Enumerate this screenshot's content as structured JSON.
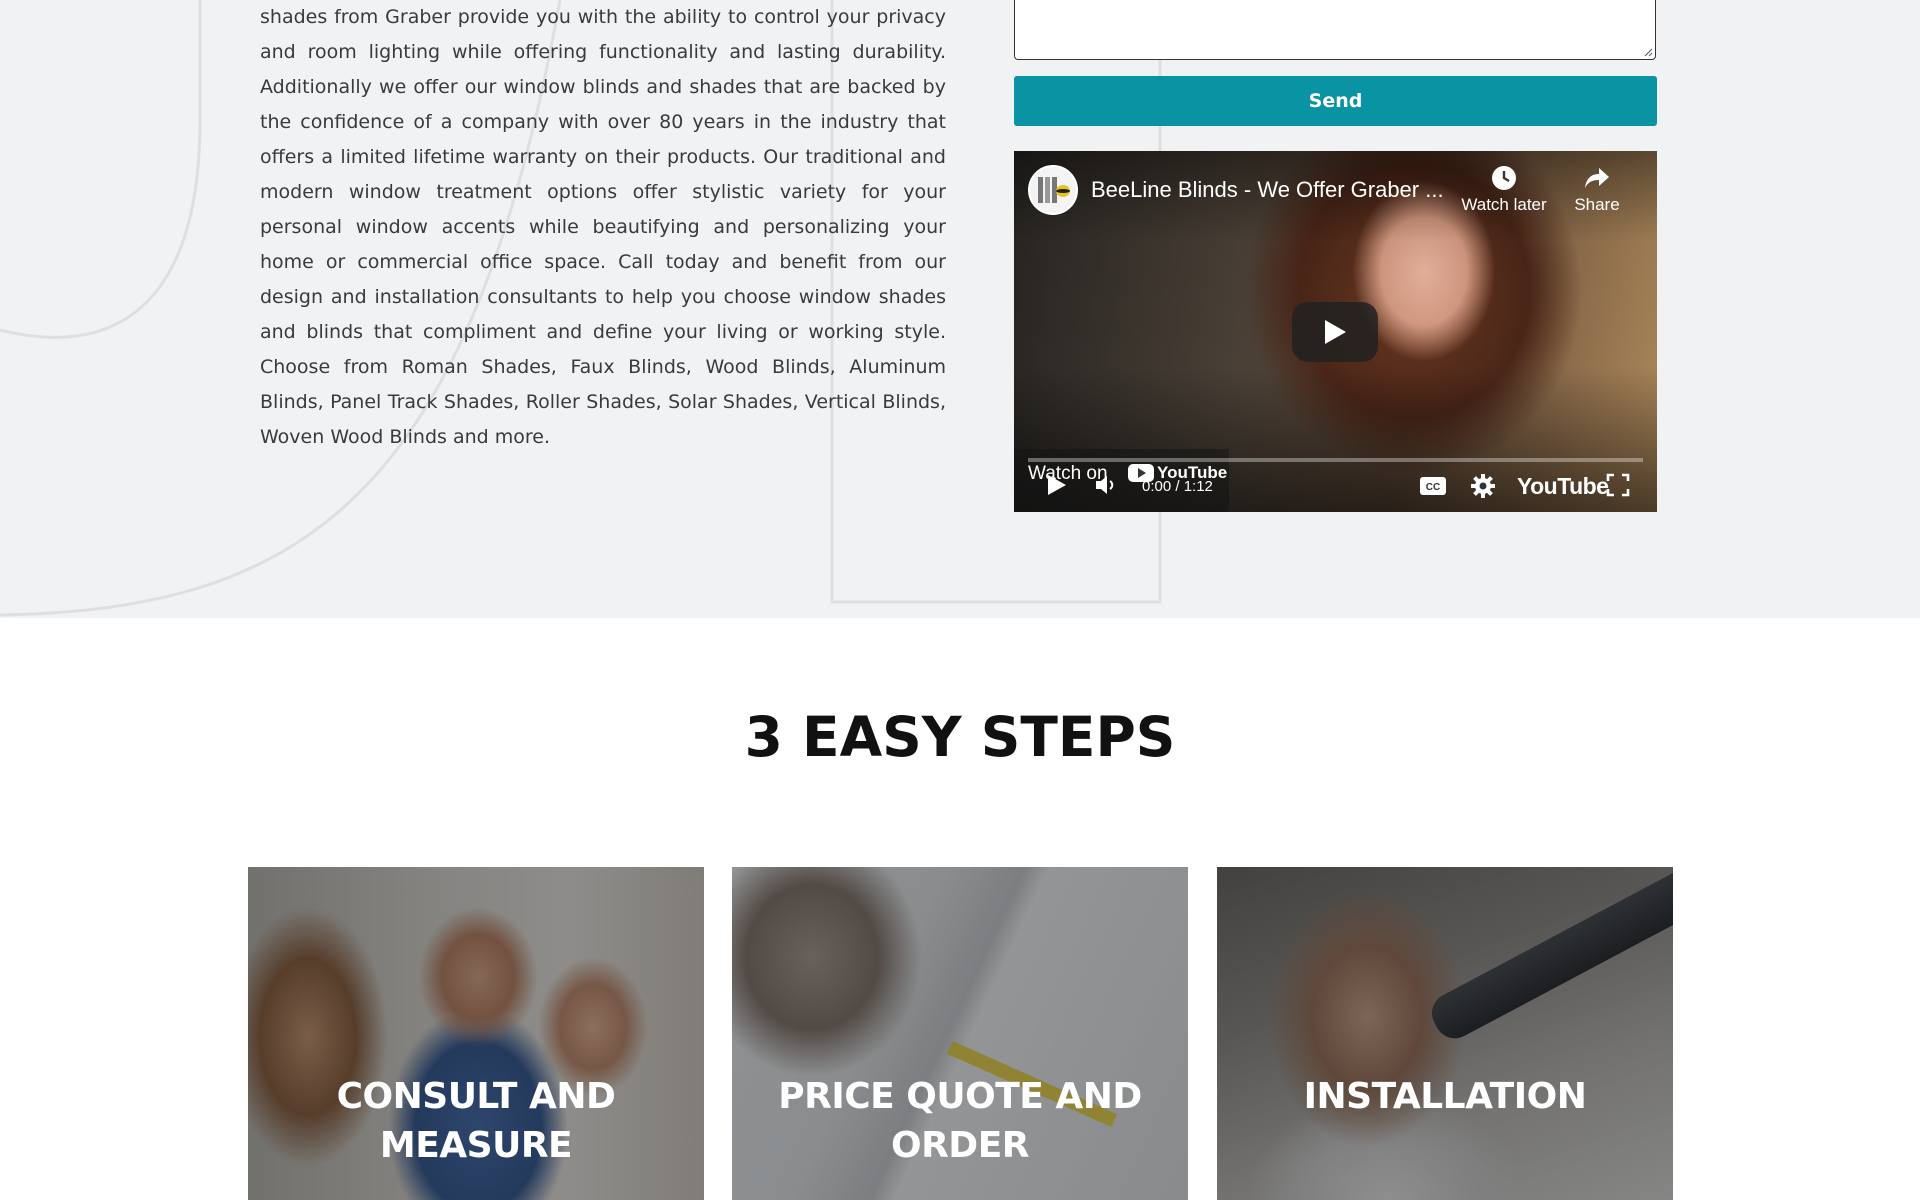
{
  "intro": {
    "paragraph": "shades from Graber provide you with the ability to control your privacy and room lighting while offering functionality and lasting durability. Additionally we offer our window blinds and shades that are backed by the confidence of a company with over 80 years in the industry that offers a limited lifetime warranty on their products. Our traditional and modern window treatment options offer stylistic variety for your personal window accents while beautifying and personalizing your home or commercial office space. Call today and benefit from our design and installation consultants to help you choose window shades and blinds that compliment and define your living or working style. Choose from Roman Shades, Faux Blinds, Wood Blinds, Aluminum Blinds, Panel Track Shades, Roller Shades, Solar Shades, Vertical Blinds, Woven Wood Blinds and more."
  },
  "form": {
    "message_value": "",
    "send_label": "Send"
  },
  "video": {
    "title": "BeeLine Blinds - We Offer Graber ...",
    "watch_later_label": "Watch later",
    "share_label": "Share",
    "watch_on_label": "Watch on",
    "watch_on_brand": "YouTube",
    "time": "0:00 / 1:12",
    "brand": "YouTube",
    "progress": 0,
    "icons": [
      "clock-icon",
      "share-icon",
      "play-icon",
      "volume-icon",
      "cc-icon",
      "gear-icon",
      "fullscreen-icon"
    ]
  },
  "steps": {
    "heading": "3 EASY STEPS",
    "items": [
      {
        "label_line1": "CONSULT AND",
        "label_line2": "MEASURE"
      },
      {
        "label_line1": "PRICE QUOTE AND",
        "label_line2": "ORDER"
      },
      {
        "label_line1": "INSTALLATION",
        "label_line2": ""
      }
    ]
  },
  "colors": {
    "accent": "#0a93a2",
    "section_bg": "#f1f2f4",
    "heading": "#111111"
  }
}
